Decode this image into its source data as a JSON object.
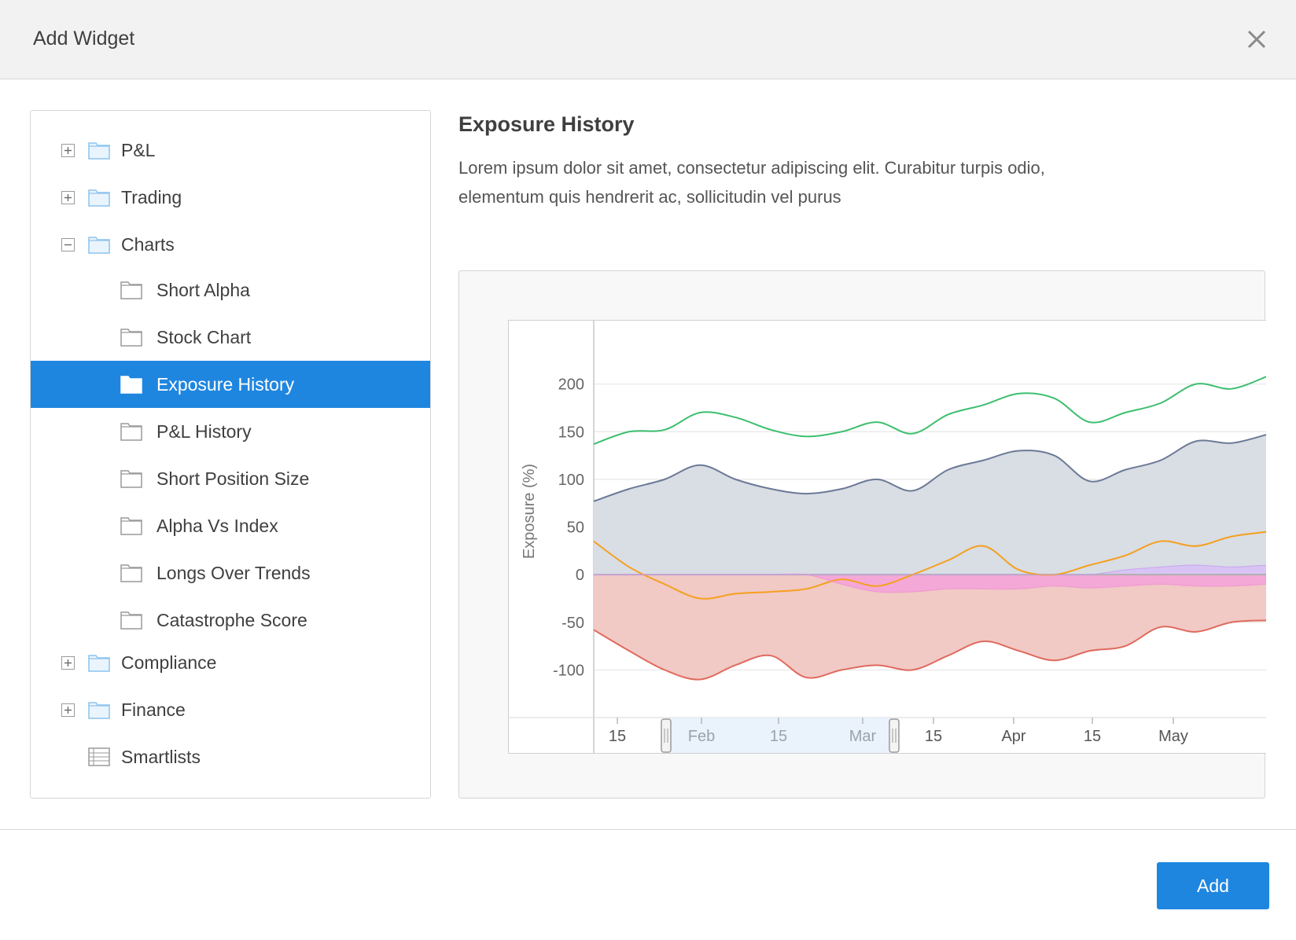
{
  "dialog": {
    "title": "Add Widget",
    "close_icon": "close-icon",
    "add_label": "Add"
  },
  "tree": {
    "items": [
      {
        "label": "P&L",
        "level": 0,
        "toggle": "plus",
        "icon": "folder-icon"
      },
      {
        "label": "Trading",
        "level": 0,
        "toggle": "plus",
        "icon": "folder-icon"
      },
      {
        "label": "Charts",
        "level": 0,
        "toggle": "minus",
        "icon": "folder-icon"
      },
      {
        "label": "Short Alpha",
        "level": 1,
        "icon": "widget-icon"
      },
      {
        "label": "Stock Chart",
        "level": 1,
        "icon": "widget-icon"
      },
      {
        "label": "Exposure History",
        "level": 1,
        "icon": "widget-icon",
        "selected": true
      },
      {
        "label": "P&L History",
        "level": 1,
        "icon": "widget-icon"
      },
      {
        "label": "Short Position Size",
        "level": 1,
        "icon": "widget-icon"
      },
      {
        "label": "Alpha Vs Index",
        "level": 1,
        "icon": "widget-icon"
      },
      {
        "label": "Longs Over Trends",
        "level": 1,
        "icon": "widget-icon"
      },
      {
        "label": "Catastrophe Score",
        "level": 1,
        "icon": "widget-icon"
      },
      {
        "label": "Compliance",
        "level": 0,
        "toggle": "plus",
        "icon": "folder-icon"
      },
      {
        "label": "Finance",
        "level": 0,
        "toggle": "plus",
        "icon": "folder-icon"
      },
      {
        "label": "Smartlists",
        "level": 0,
        "icon": "list-icon"
      }
    ]
  },
  "detail": {
    "title": "Exposure History",
    "description": "Lorem ipsum dolor sit amet, consectetur adipiscing elit. Curabitur turpis odio, elementum quis hendrerit ac, sollicitudin vel purus"
  },
  "colors": {
    "accent": "#1f86e0",
    "green": "#3cbf6e",
    "slate": "#6b7a96",
    "slate_fill": "#d9dde4",
    "orange": "#f5a01e",
    "red": "#e06a5e",
    "red_fill": "#f1c9c5",
    "pink": "#f08fd0",
    "purple": "#c39bf0"
  },
  "chart_data": {
    "type": "area",
    "ylabel": "Exposure (%)",
    "ylim": [
      -150,
      250
    ],
    "yticks": [
      200,
      150,
      100,
      50,
      0,
      -50,
      -100
    ],
    "xtick_labels": [
      "15",
      "Feb",
      "15",
      "Mar",
      "15",
      "Apr",
      "15",
      "May"
    ],
    "x": [
      "Jan 5",
      "Jan 12",
      "Jan 19",
      "Jan 26",
      "Feb 2",
      "Feb 9",
      "Feb 16",
      "Feb 23",
      "Mar 2",
      "Mar 9",
      "Mar 16",
      "Mar 23",
      "Mar 30",
      "Apr 6",
      "Apr 13",
      "Apr 20",
      "Apr 27",
      "May 4",
      "May 11",
      "May 18"
    ],
    "navigator_range": [
      "Jan 28",
      "Mar 14"
    ],
    "series": [
      {
        "color": "#3cbf6e",
        "fill": false,
        "values": [
          137,
          150,
          152,
          170,
          165,
          152,
          145,
          150,
          160,
          148,
          168,
          178,
          190,
          185,
          160,
          170,
          180,
          200,
          195,
          208
        ]
      },
      {
        "color": "#6b7a96",
        "fill": true,
        "values": [
          77,
          90,
          100,
          115,
          100,
          90,
          85,
          90,
          100,
          88,
          110,
          120,
          130,
          125,
          98,
          110,
          120,
          140,
          138,
          147
        ]
      },
      {
        "color": "#f5a01e",
        "fill": false,
        "values": [
          35,
          8,
          -10,
          -25,
          -20,
          -18,
          -15,
          -5,
          -12,
          0,
          15,
          30,
          5,
          0,
          10,
          20,
          35,
          30,
          40,
          45
        ]
      },
      {
        "color": "#e06a5e",
        "fill": true,
        "values": [
          -58,
          -80,
          -100,
          -110,
          -95,
          -85,
          -108,
          -100,
          -95,
          -100,
          -85,
          -70,
          -80,
          -90,
          -80,
          -75,
          -55,
          -60,
          -50,
          -48
        ]
      },
      {
        "color": "#f08fd0",
        "fill": true,
        "values": [
          0,
          0,
          0,
          0,
          0,
          0,
          0,
          -10,
          -18,
          -18,
          -15,
          -15,
          -15,
          -12,
          -14,
          -12,
          -10,
          -12,
          -12,
          -10
        ]
      },
      {
        "color": "#c39bf0",
        "fill": true,
        "values": [
          0,
          0,
          0,
          0,
          0,
          0,
          0,
          0,
          0,
          0,
          0,
          0,
          0,
          0,
          0,
          5,
          8,
          10,
          8,
          10
        ]
      }
    ]
  }
}
